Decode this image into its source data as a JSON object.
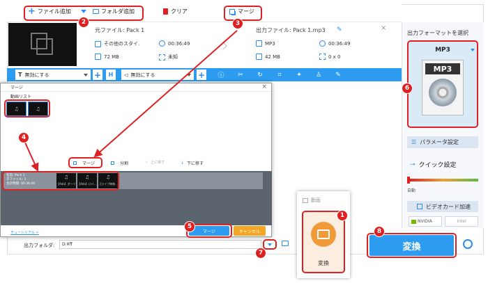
{
  "toolbar": {
    "add_file": "ファイル追加",
    "add_folder": "フォルダ追加",
    "clear": "クリア",
    "merge": "マージ"
  },
  "file": {
    "source_label": "元ファイル: Pack 1",
    "output_label": "出力ファイル: Pack 1.mp3",
    "src_format": "その他のスタイ.",
    "src_duration": "00:36:49",
    "src_size": "72 MB",
    "src_resolution": "未知",
    "out_format": "MP3",
    "out_duration": "00:36:49",
    "out_size": "42 MB",
    "out_resolution": "0 x 0"
  },
  "edit_bar": {
    "subtitle_select": "無効にする",
    "audio_select": "無効にする"
  },
  "right_panel": {
    "title": "出力フォーマットを選択",
    "format_name": "MP3",
    "format_icon_text": "MP3",
    "param_settings": "パラメータ設定",
    "quick_settings": "クイック設定",
    "auto_label": "自動",
    "gpu_accel": "ビデオカード加速",
    "nvidia": "NVIDIA",
    "intel": "Intel"
  },
  "merge_dialog": {
    "title": "マージ",
    "video_list_label": "動画リスト",
    "merge_btn_small": "マージ",
    "split_btn": "分割",
    "move_up": "上に移す",
    "move_down": "下に移す",
    "pack_info_1": "名前: Pack 1",
    "pack_info_2": "子ファイル: 3",
    "pack_info_3": "合計時間: 00:36:49",
    "clip_1": "【Ado】ダーリン",
    "clip_2": "【Ado】ロイ...",
    "clip_3": "【ライブ映像...",
    "tutorial_link": "チュートリアル >",
    "merge_button": "マージ",
    "cancel_button": "キャンセル"
  },
  "bottom": {
    "output_folder_label": "出力フォルダ:",
    "output_folder_value": "D:¥ff",
    "convert_button": "変換"
  },
  "popup": {
    "video_label": "動画",
    "convert_label": "変換"
  },
  "badges": [
    "1",
    "2",
    "3",
    "4",
    "5",
    "6",
    "7",
    "8"
  ],
  "colors": {
    "accent": "#2d9cf0",
    "annotation": "#e02020",
    "orange": "#f0a030",
    "merge_btn": "#2d9cf0",
    "cancel_btn": "#f5a623"
  }
}
